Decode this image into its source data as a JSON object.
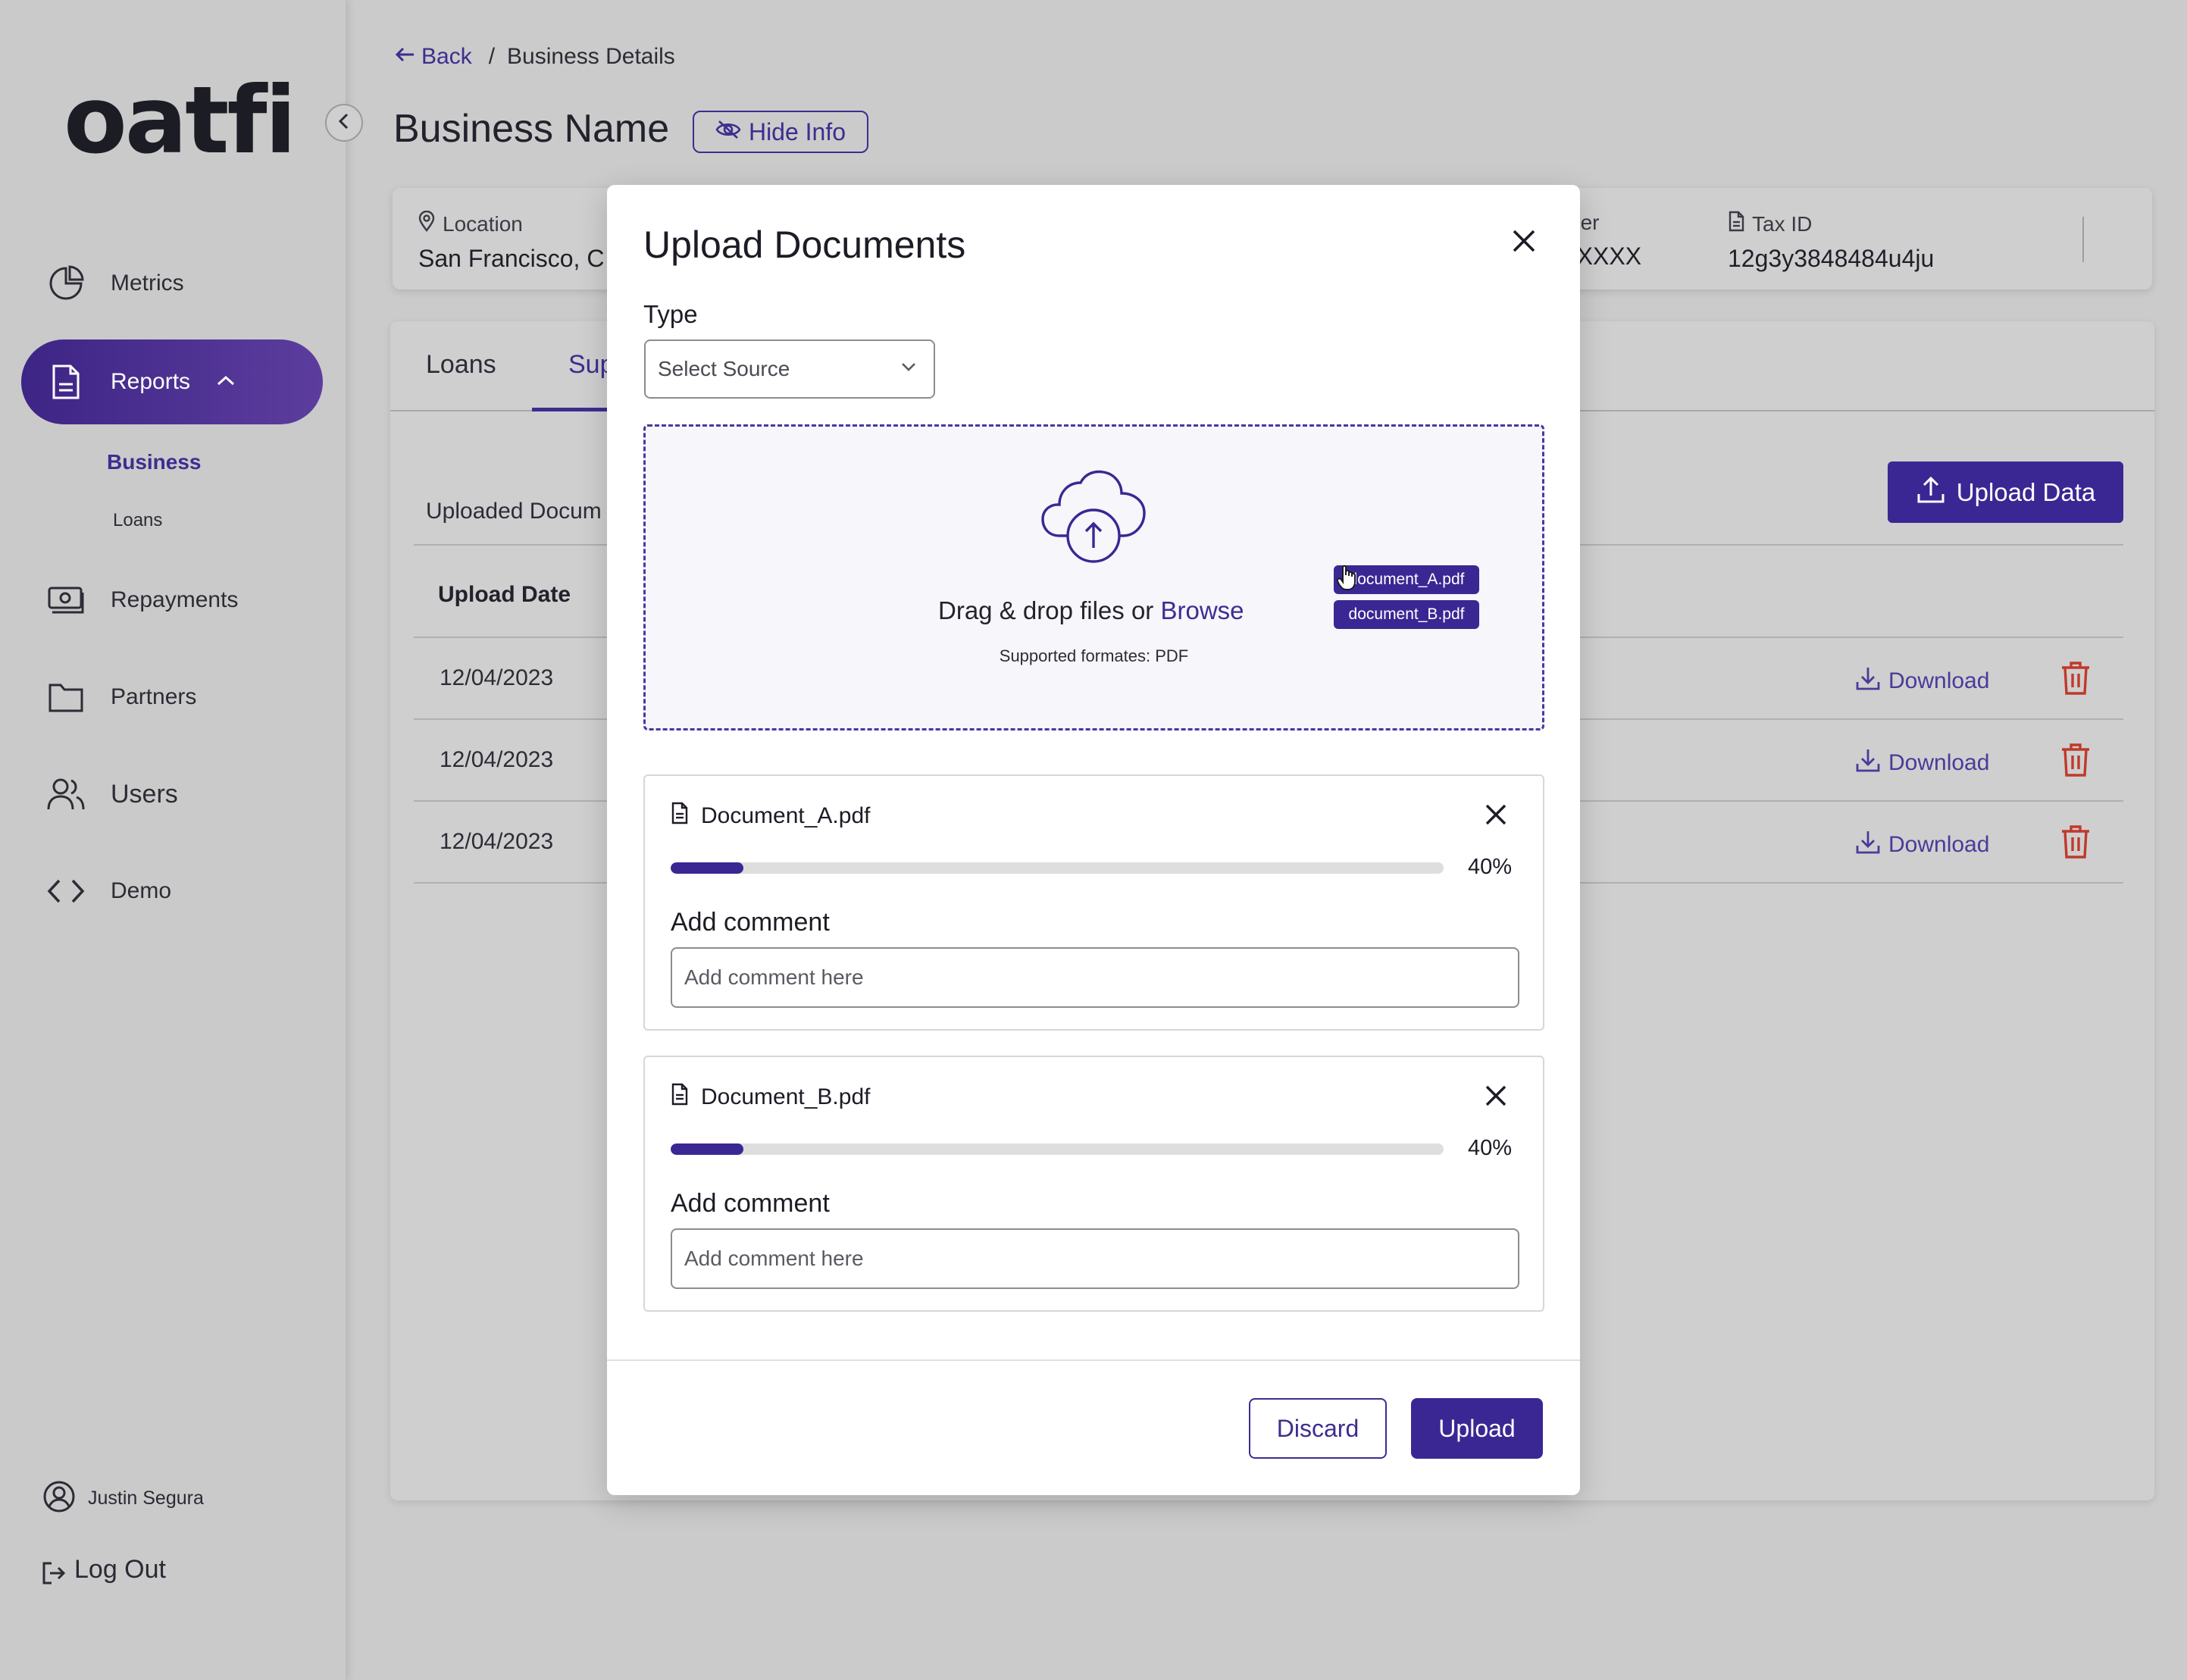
{
  "brand": {
    "logo_text": "oatfi",
    "accent_color": "#3b2793",
    "danger_color": "#c0392b"
  },
  "sidebar": {
    "items": [
      {
        "label": "Metrics",
        "icon": "pie-chart-icon"
      },
      {
        "label": "Reports",
        "icon": "document-icon",
        "active": true,
        "expanded": true
      },
      {
        "label": "Repayments",
        "icon": "cash-icon"
      },
      {
        "label": "Partners",
        "icon": "folder-icon"
      },
      {
        "label": "Users",
        "icon": "users-icon"
      },
      {
        "label": "Demo",
        "icon": "code-icon"
      }
    ],
    "sub_items": [
      {
        "label": "Business",
        "active": true
      },
      {
        "label": "Loans"
      }
    ],
    "user_name": "Justin Segura",
    "logout_label": "Log Out"
  },
  "breadcrumb": {
    "back_label": "Back",
    "separator": "/",
    "current": "Business Details"
  },
  "page": {
    "title": "Business Name",
    "hide_info_label": "Hide Info"
  },
  "info": {
    "location_label": "Location",
    "location_value": "San Francisco, C",
    "phone_label_partial": "ber",
    "phone_value_partial": "-XXXX",
    "tax_label": "Tax ID",
    "tax_value": "12g3y3848484u4ju"
  },
  "tabs": [
    {
      "label": "Loans"
    },
    {
      "label": "Sup",
      "active": true
    }
  ],
  "documents": {
    "section_title": "Uploaded Docum",
    "upload_button": "Upload Data",
    "columns": {
      "upload_date": "Upload Date"
    },
    "rows": [
      {
        "date": "12/04/2023",
        "download_label": "Download"
      },
      {
        "date": "12/04/2023",
        "download_label": "Download"
      },
      {
        "date": "12/04/2023",
        "download_label": "Download"
      }
    ]
  },
  "modal": {
    "title": "Upload Documents",
    "type_label": "Type",
    "select_placeholder": "Select Source",
    "drop_text": "Drag & drop files or ",
    "browse_label": "Browse",
    "supported_text": "Supported formates: PDF",
    "dragging_chips": [
      "document_A.pdf",
      "document_B.pdf"
    ],
    "files": [
      {
        "name": "Document_A.pdf",
        "progress": 40,
        "progress_label": "40%",
        "comment_label": "Add comment",
        "comment_placeholder": "Add comment here"
      },
      {
        "name": "Document_B.pdf",
        "progress": 40,
        "progress_label": "40%",
        "comment_label": "Add comment",
        "comment_placeholder": "Add comment here"
      }
    ],
    "discard_label": "Discard",
    "upload_label": "Upload"
  }
}
